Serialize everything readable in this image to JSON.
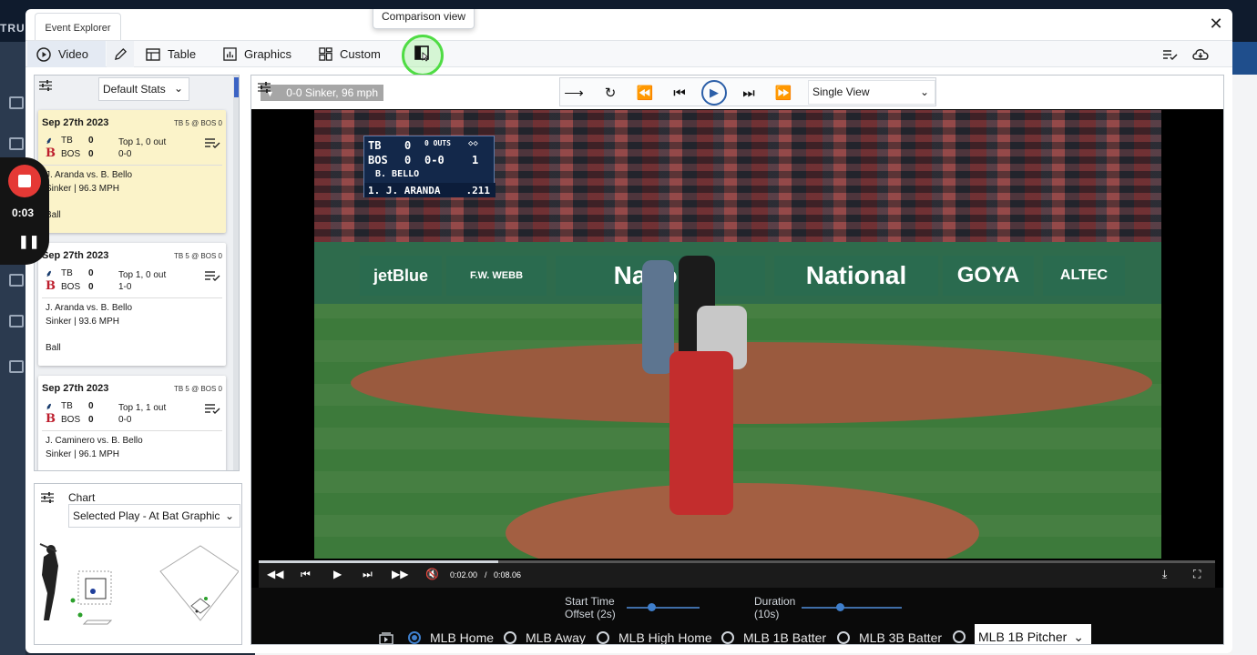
{
  "background": {
    "logo_text": "TRU"
  },
  "modal": {
    "tab_label": "Event Explorer",
    "close_glyph": "✕"
  },
  "toolbar": {
    "items": [
      {
        "label": "Video",
        "icon": "play-circle-icon",
        "active": true
      },
      {
        "label": "",
        "icon": "pencil-icon",
        "active": false
      },
      {
        "label": "Table",
        "icon": "table-icon",
        "active": false
      },
      {
        "label": "Graphics",
        "icon": "bar-chart-icon",
        "active": false
      },
      {
        "label": "Custom",
        "icon": "grid-icon",
        "active": false
      },
      {
        "label": "",
        "icon": "comparison-view-icon",
        "active": false
      }
    ],
    "tooltip": "Comparison view",
    "right_icons": [
      "playlist-check-icon",
      "cloud-download-icon"
    ]
  },
  "list_panel": {
    "stats_select": "Default Stats",
    "cards": [
      {
        "date": "Sep 27th 2023",
        "matchup": "TB 5 @ BOS 0",
        "away_team": "TB",
        "away_score": "0",
        "home_team": "BOS",
        "home_score": "0",
        "inning": "Top 1, 0 out",
        "count": "0-0",
        "at_bat": "J. Aranda vs. B. Bello",
        "pitch": "Sinker | 96.3 MPH",
        "result": "Ball",
        "selected": true
      },
      {
        "date": "Sep 27th 2023",
        "matchup": "TB 5 @ BOS 0",
        "away_team": "TB",
        "away_score": "0",
        "home_team": "BOS",
        "home_score": "0",
        "inning": "Top 1, 0 out",
        "count": "1-0",
        "at_bat": "J. Aranda vs. B. Bello",
        "pitch": "Sinker | 93.6 MPH",
        "result": "Ball",
        "selected": false
      },
      {
        "date": "Sep 27th 2023",
        "matchup": "TB 5 @ BOS 0",
        "away_team": "TB",
        "away_score": "0",
        "home_team": "BOS",
        "home_score": "0",
        "inning": "Top 1, 1 out",
        "count": "0-0",
        "at_bat": "J. Caminero vs. B. Bello",
        "pitch": "Sinker | 96.1 MPH",
        "result": "",
        "selected": false
      }
    ]
  },
  "chart_panel": {
    "title": "Chart",
    "select": "Selected Play - At Bat Graphic"
  },
  "video": {
    "view_select": "Single View",
    "controls": [
      "arrow-right-icon",
      "replay-icon",
      "rewind-icon",
      "skip-previous-icon",
      "play-icon",
      "skip-next-icon",
      "fast-forward-icon"
    ],
    "clip_label": "0-0 Sinker, 96 mph",
    "scoreboard": {
      "away": "TB",
      "away_score": "0",
      "home": "BOS",
      "home_score": "0",
      "outs": "0 OUTS",
      "count": "0-0",
      "inning": "1",
      "pitcher": "B. BELLO",
      "batter": "1. J. ARANDA",
      "avg": ".211"
    },
    "ads": [
      "jetBlue",
      "F.W. WEBB",
      "Nationa",
      "National",
      "GOYA",
      "ALTEC"
    ],
    "current_time": "0:02.00",
    "separator": "/",
    "total_time": "0:08.06",
    "progress": 0.25,
    "start_time_label": "Start Time",
    "start_time_sub": "Offset (2s)",
    "duration_label": "Duration",
    "duration_sub": "(10s)",
    "cameras": [
      {
        "label": "MLB Home",
        "selected": true
      },
      {
        "label": "MLB Away",
        "selected": false
      },
      {
        "label": "MLB High Home",
        "selected": false
      },
      {
        "label": "MLB 1B Batter",
        "selected": false
      },
      {
        "label": "MLB 3B Batter",
        "selected": false
      }
    ],
    "camera_select": "MLB 1B Pitcher"
  },
  "recorder": {
    "time": "0:03"
  },
  "colors": {
    "accent": "#2c5fa8",
    "record": "#e53935",
    "selected_card": "#fbf3c9",
    "highlight_ring": "#4fdc44"
  }
}
